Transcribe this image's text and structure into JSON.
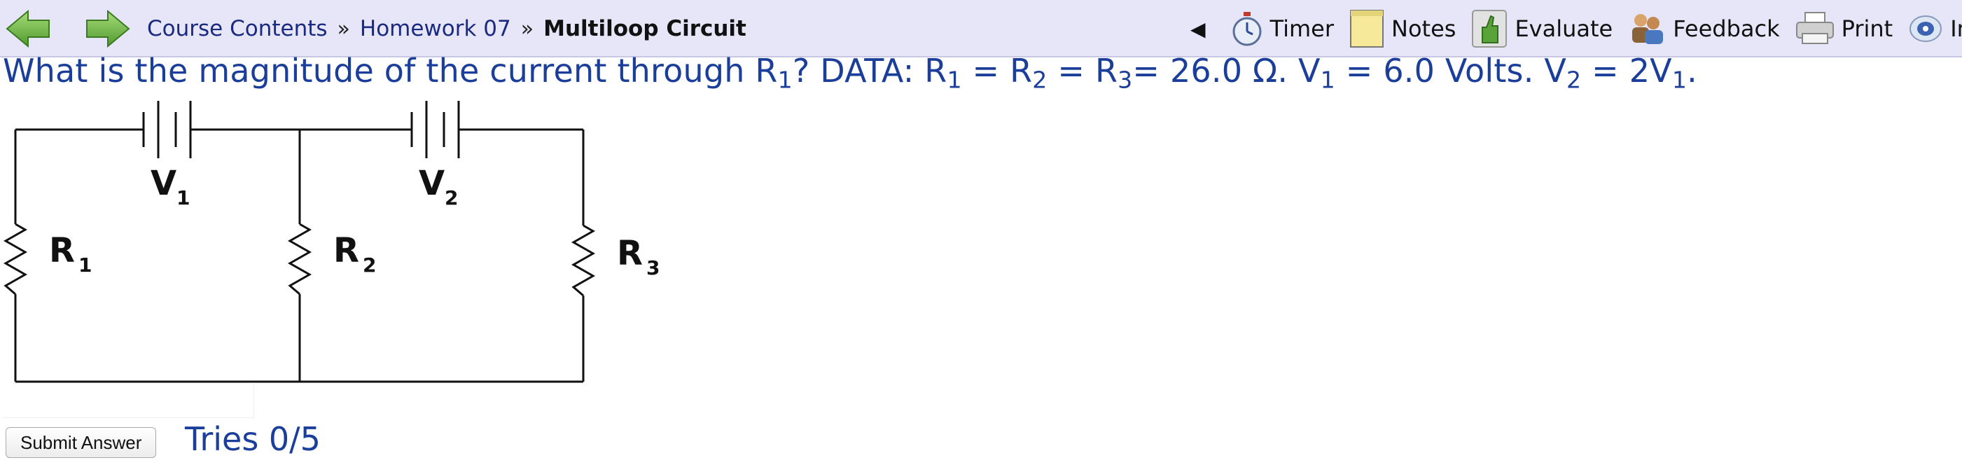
{
  "breadcrumb": {
    "course_contents": "Course Contents",
    "separator": "»",
    "homework": "Homework 07",
    "current": "Multiloop Circuit"
  },
  "toolbar": {
    "timer": "Timer",
    "notes": "Notes",
    "evaluate": "Evaluate",
    "feedback": "Feedback",
    "print": "Print",
    "info": "Info"
  },
  "icons": [
    "back-arrow-icon",
    "forward-arrow-icon",
    "collapse-triangle-icon",
    "timer-icon",
    "notes-icon",
    "evaluate-icon",
    "feedback-icon",
    "print-icon",
    "info-icon"
  ],
  "question": {
    "t1": "What is the magnitude of the current through R",
    "s1": "1",
    "t2": "? DATA: R",
    "s2": "1",
    "t3": " = R",
    "s3": "2",
    "t4": " = R",
    "s4": "3",
    "t5": "= 26.0 Ω. V",
    "s5": "1",
    "t6": " = 6.0 Volts. V",
    "s6": "2",
    "t7": " = 2V",
    "s7": "1",
    "t8": "."
  },
  "circuit": {
    "v1": "V",
    "v1_sub": "1",
    "v2": "V",
    "v2_sub": "2",
    "r1": "R",
    "r1_sub": "1",
    "r2": "R",
    "r2_sub": "2",
    "r3": "R",
    "r3_sub": "3"
  },
  "answer": {
    "input_value": "",
    "submit_label": "Submit Answer",
    "tries": "Tries 0/5"
  },
  "colors": {
    "toolbar_bg": "#e6e6f8",
    "question_text": "#1a3e9a",
    "nav_arrow": "#6ab04a"
  }
}
